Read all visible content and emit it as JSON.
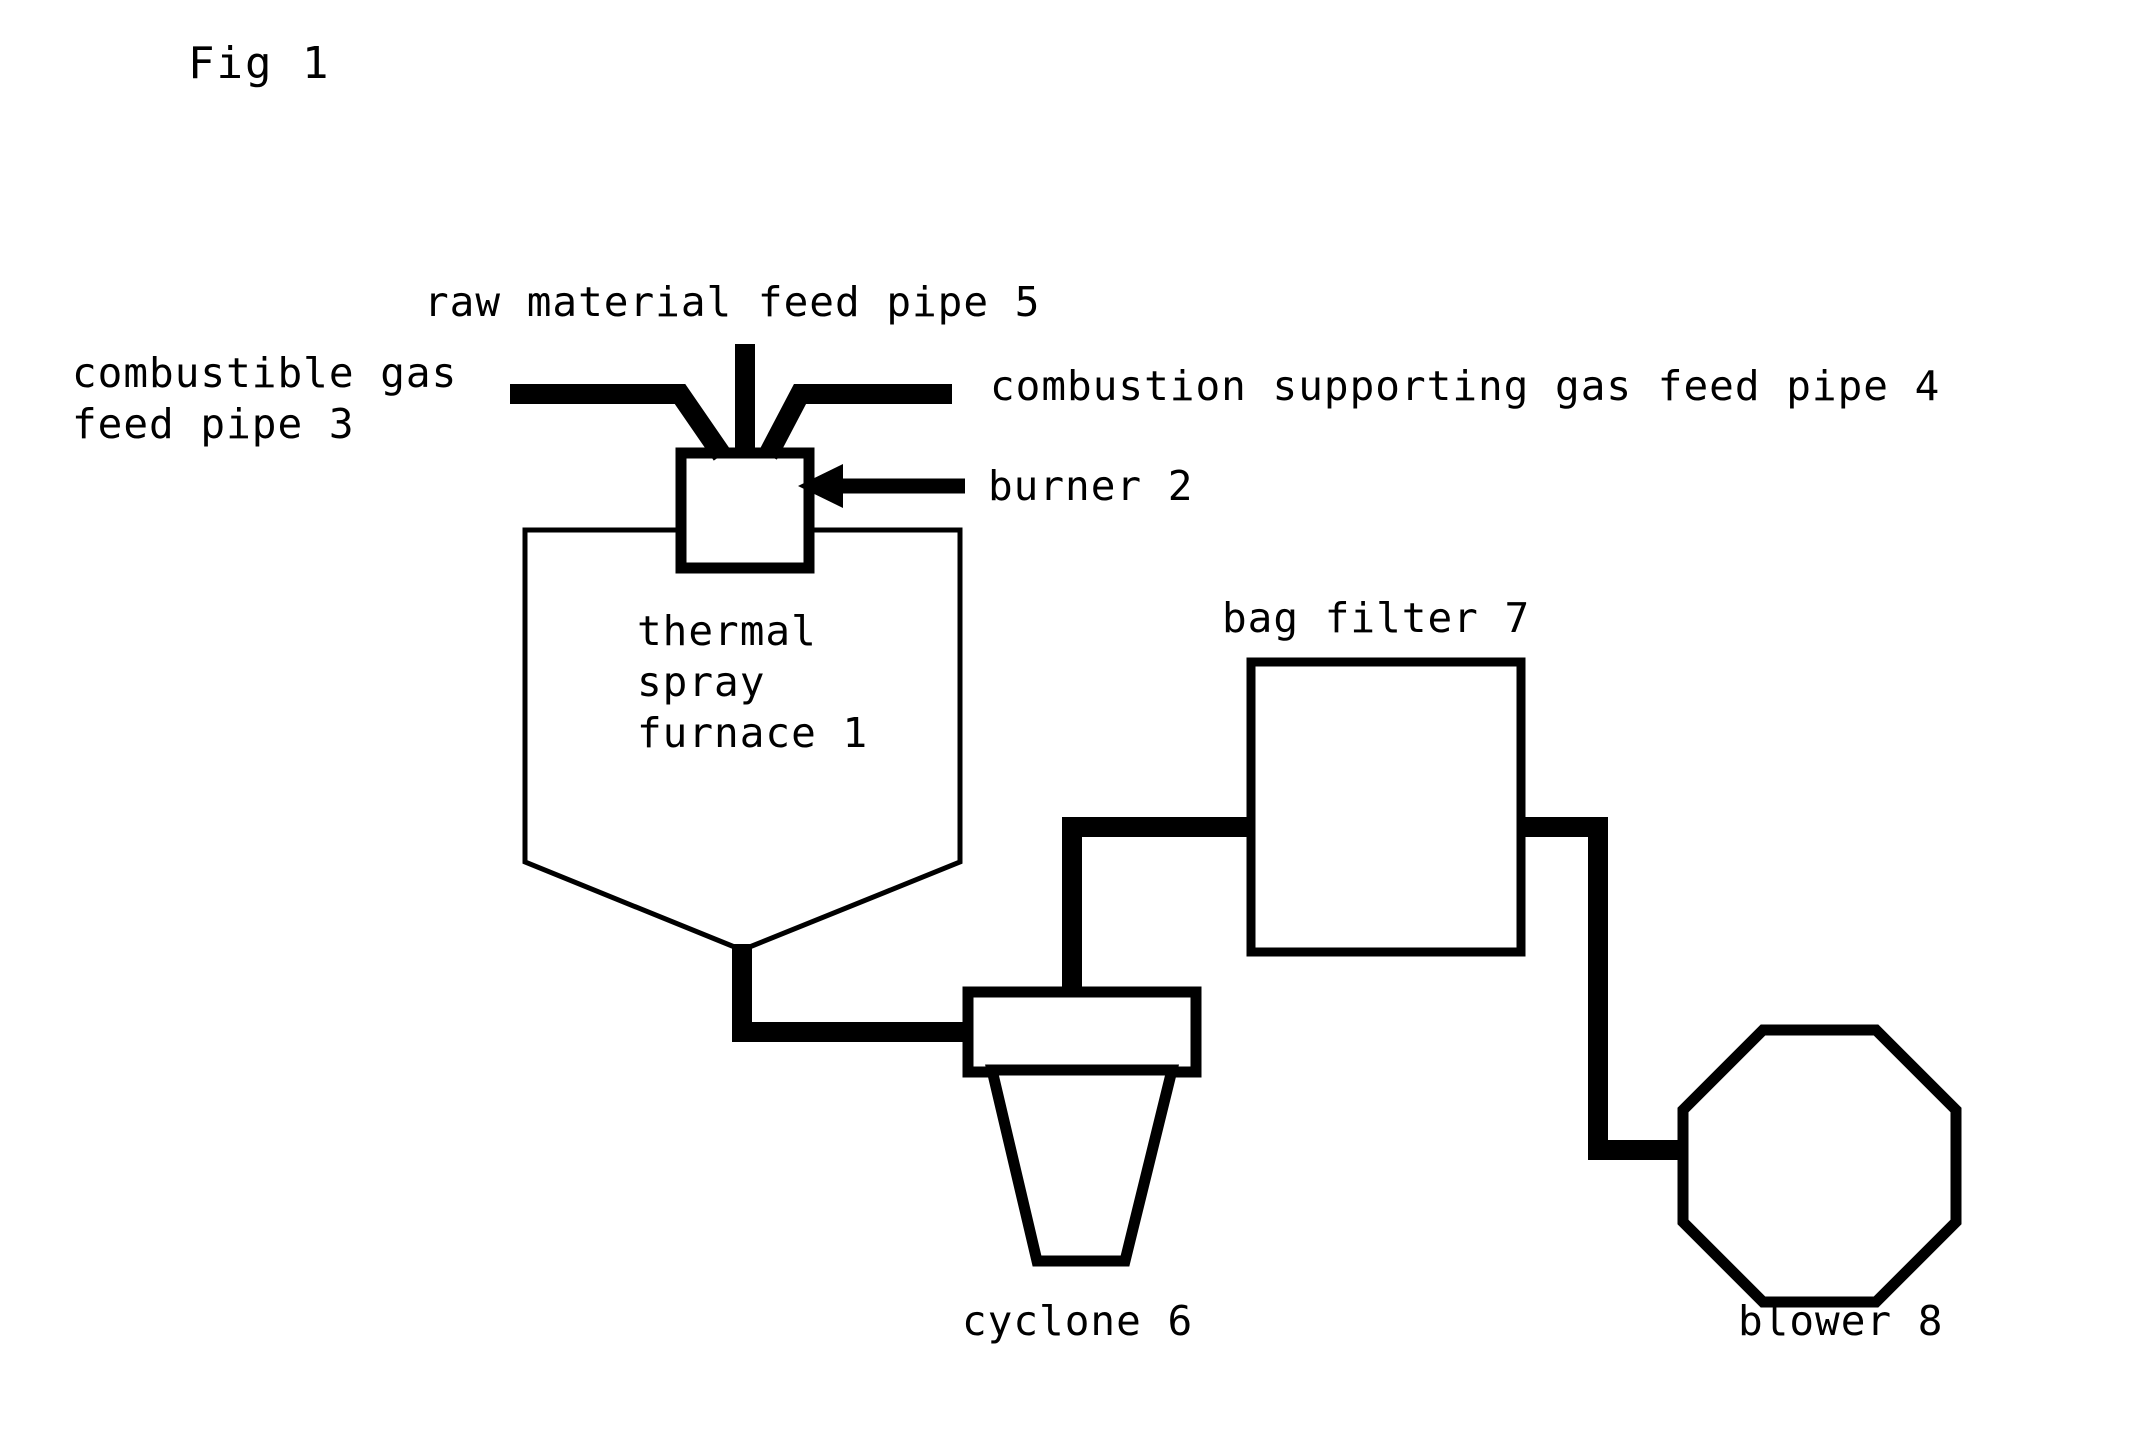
{
  "figure": {
    "title": "Fig 1",
    "background_color": "#ffffff",
    "line_color": "#000000"
  },
  "labels": {
    "raw_material_feed_pipe": "raw material feed pipe 5",
    "combustible_gas_feed_pipe_line1": "combustible gas",
    "combustible_gas_feed_pipe_line2": "feed pipe 3",
    "combustion_supporting_gas_feed_pipe": "combustion supporting gas feed pipe 4",
    "burner": "burner 2",
    "thermal_spray_furnace_line1": "thermal",
    "thermal_spray_furnace_line2": "spray",
    "thermal_spray_furnace_line3": "furnace 1",
    "bag_filter": "bag filter 7",
    "cyclone": "cyclone 6",
    "blower": "blower 8"
  },
  "components": [
    {
      "id": 1,
      "name": "thermal spray furnace",
      "shape": "pentagon-hopper"
    },
    {
      "id": 2,
      "name": "burner",
      "shape": "rectangle"
    },
    {
      "id": 3,
      "name": "combustible gas feed pipe",
      "shape": "pipe"
    },
    {
      "id": 4,
      "name": "combustion supporting gas feed pipe",
      "shape": "pipe"
    },
    {
      "id": 5,
      "name": "raw material feed pipe",
      "shape": "pipe"
    },
    {
      "id": 6,
      "name": "cyclone",
      "shape": "rectangle-with-cone"
    },
    {
      "id": 7,
      "name": "bag filter",
      "shape": "rectangle"
    },
    {
      "id": 8,
      "name": "blower",
      "shape": "octagon"
    }
  ],
  "flow": [
    "thermal spray furnace 1 -> cyclone 6",
    "cyclone 6 -> bag filter 7",
    "bag filter 7 -> blower 8"
  ]
}
